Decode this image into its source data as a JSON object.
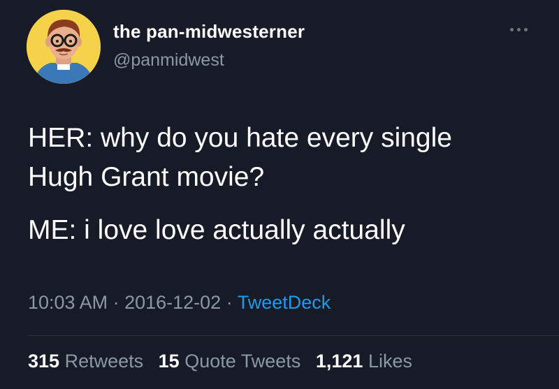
{
  "user": {
    "display_name": "the pan-midwesterner",
    "handle": "@panmidwest",
    "avatar_icon": "cartoon-priest-avatar-icon"
  },
  "more_icon": "more-horizontal-icon",
  "tweet": {
    "lines": [
      "HER: why do you hate every single",
      "Hugh Grant movie?",
      "ME: i love love actually actually"
    ]
  },
  "meta": {
    "time": "10:03 AM",
    "separator": " · ",
    "date": "2016-12-02",
    "source": "TweetDeck"
  },
  "stats": {
    "retweets_count": "315",
    "retweets_label": "Retweets",
    "quotes_count": "15",
    "quotes_label": "Quote Tweets",
    "likes_count": "1,121",
    "likes_label": "Likes"
  },
  "colors": {
    "background": "#161b27",
    "text": "#ffffff",
    "secondary_text": "#8b98a5",
    "link": "#1d9bf0",
    "avatar_background": "#f6d24a"
  }
}
